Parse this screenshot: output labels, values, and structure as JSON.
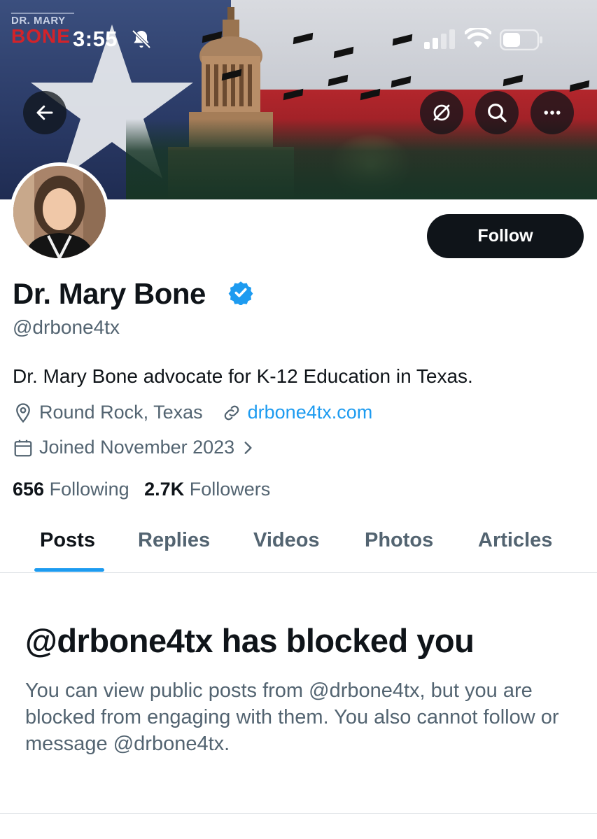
{
  "status_bar": {
    "time": "3:55",
    "icons": [
      "bell-slash-icon",
      "cellular-signal-icon",
      "wifi-icon",
      "battery-icon"
    ]
  },
  "banner": {
    "logo_line1": "DR. MARY",
    "logo_line2": "BONE",
    "description": "Texas flag with capitol and graduates tossing caps"
  },
  "header_buttons": {
    "back": "back-arrow-icon",
    "grok": "grok-icon",
    "search": "search-icon",
    "more": "more-icon"
  },
  "profile": {
    "display_name": "Dr. Mary Bone",
    "verified": true,
    "handle": "@drbone4tx",
    "bio": "Dr. Mary Bone advocate for K-12 Education in Texas.",
    "location": "Round Rock, Texas",
    "website": "drbone4tx.com",
    "joined": "Joined November 2023",
    "following_count": "656",
    "following_label": "Following",
    "followers_count": "2.7K",
    "followers_label": "Followers"
  },
  "follow_button": {
    "label": "Follow"
  },
  "tabs": [
    {
      "label": "Posts",
      "active": true
    },
    {
      "label": "Replies",
      "active": false
    },
    {
      "label": "Videos",
      "active": false
    },
    {
      "label": "Photos",
      "active": false
    },
    {
      "label": "Articles",
      "active": false
    }
  ],
  "blocked_notice": {
    "title": "@drbone4tx has blocked you",
    "body": "You can view public posts from @drbone4tx, but you are blocked from engaging with them. You also cannot follow or message @drbone4tx."
  },
  "colors": {
    "accent": "#1d9bf0",
    "text_primary": "#0f1419",
    "text_secondary": "#536471",
    "button_dark": "#0f1419"
  }
}
